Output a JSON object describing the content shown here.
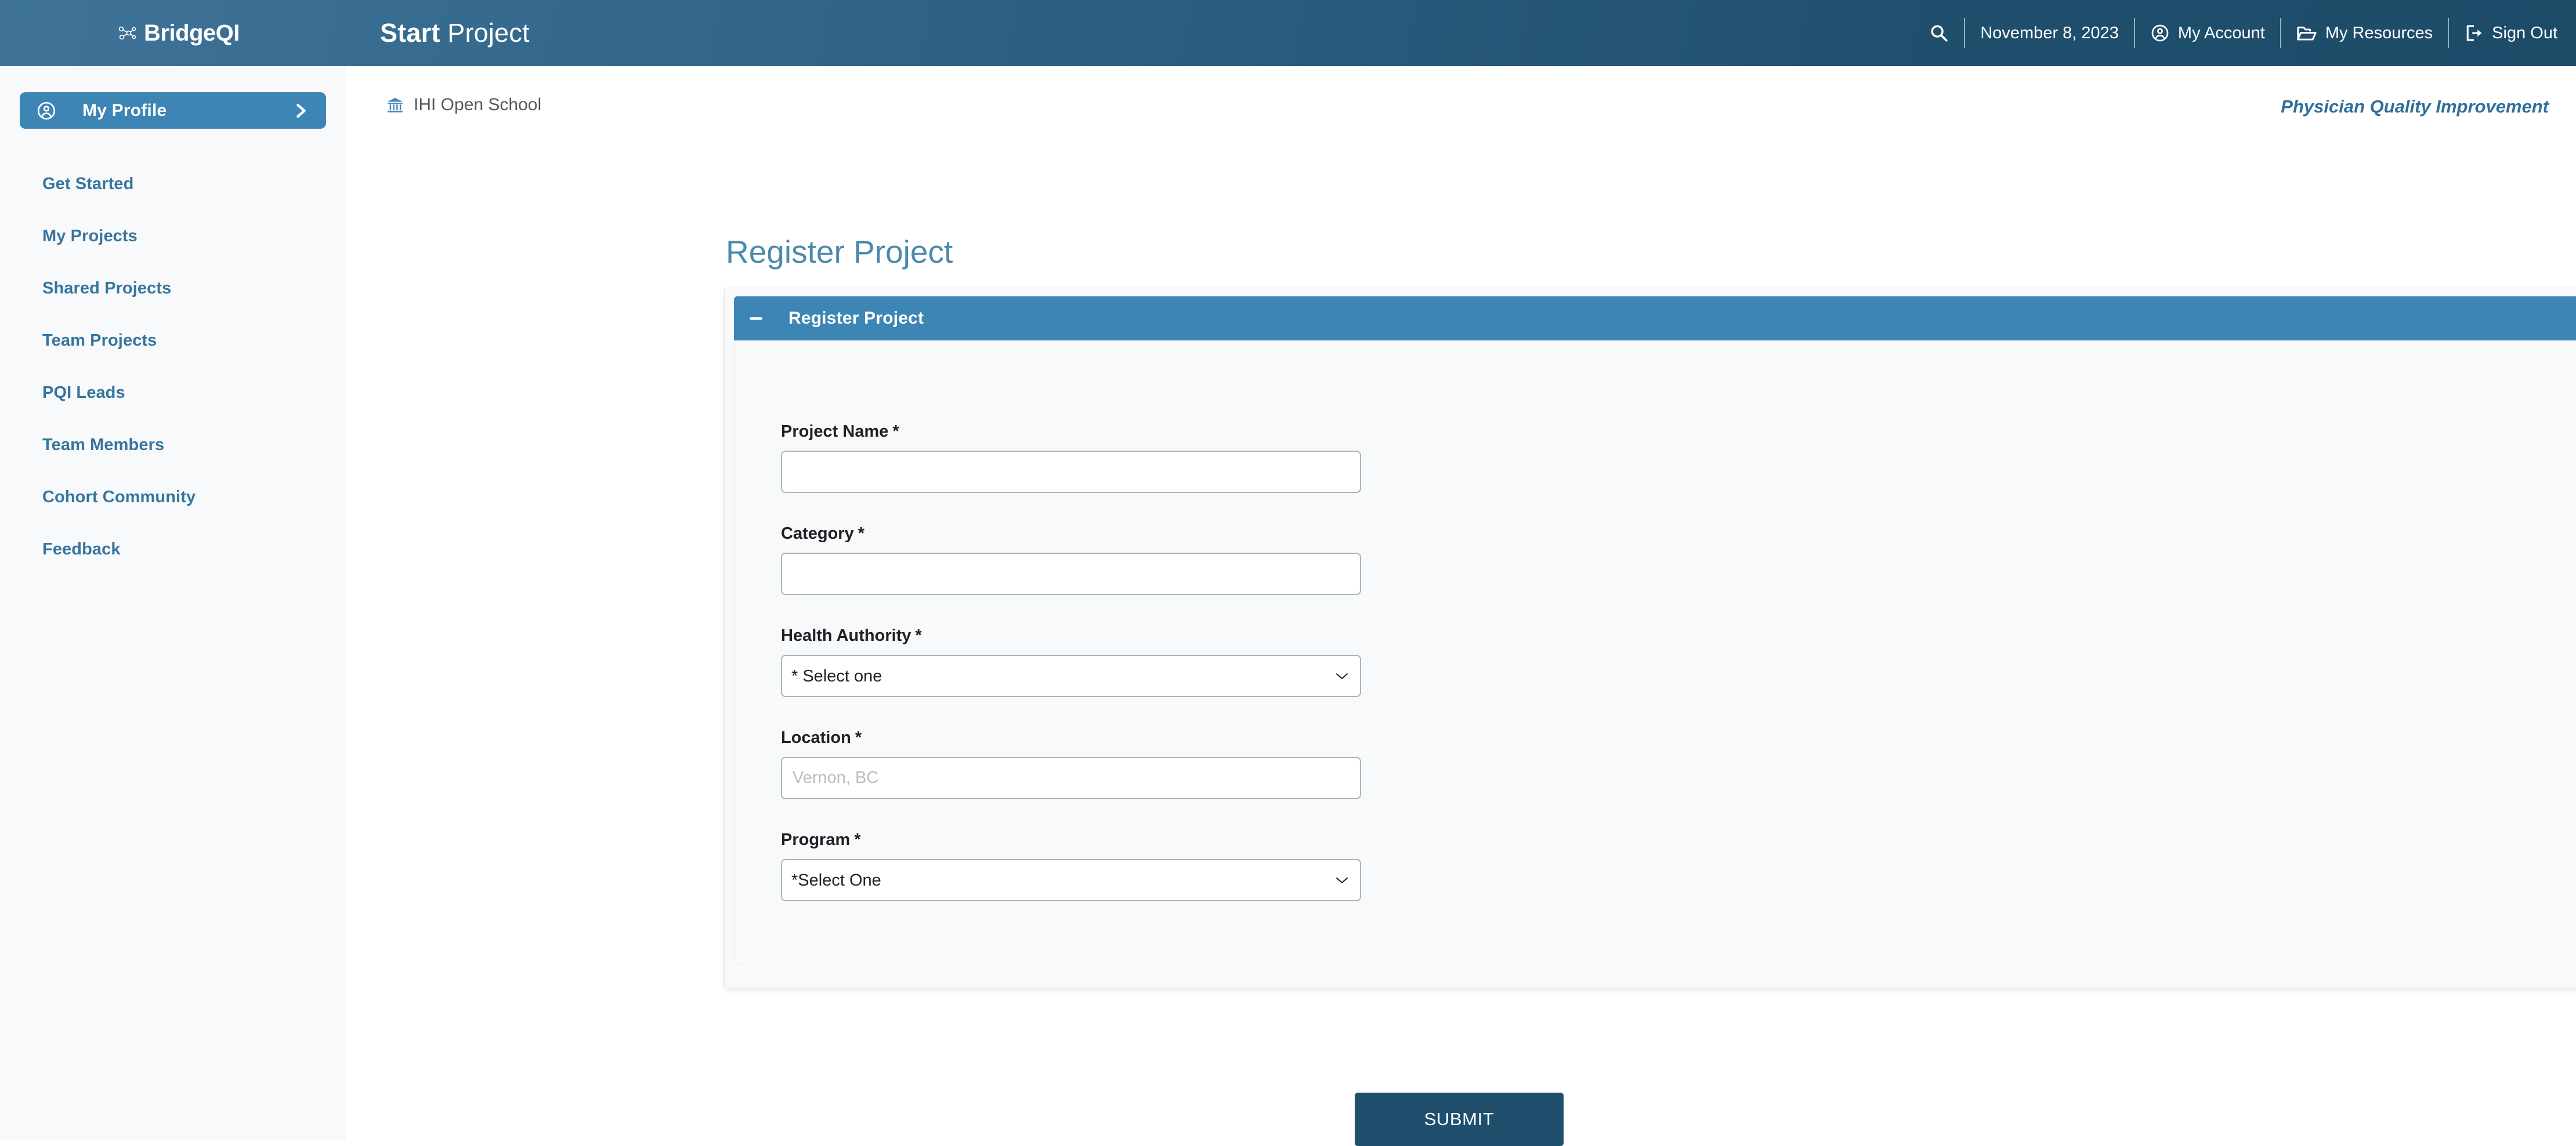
{
  "header": {
    "brand": "BridgeQI",
    "title_bold": "Start",
    "title_rest": " Project",
    "date": "November 8, 2023",
    "nav": [
      {
        "label": "My Account",
        "icon": "user-circle-icon"
      },
      {
        "label": "My Resources",
        "icon": "folder-open-icon"
      },
      {
        "label": "Sign Out",
        "icon": "sign-out-icon"
      }
    ],
    "search_icon": "search-icon",
    "colors": {
      "bar_left": "#3f7498",
      "bar_right": "#1d4c69"
    }
  },
  "sidebar": {
    "profile": {
      "label": "My Profile",
      "icon": "user-circle-icon",
      "chevron": "chevron-right-icon"
    },
    "items": [
      {
        "label": "Get Started"
      },
      {
        "label": "My Projects"
      },
      {
        "label": "Shared Projects"
      },
      {
        "label": "Team Projects"
      },
      {
        "label": "PQI Leads"
      },
      {
        "label": "Team Members"
      },
      {
        "label": "Cohort Community"
      },
      {
        "label": "Feedback"
      }
    ],
    "colors": {
      "active_bg": "#3d85b4",
      "link": "#36759d",
      "bg": "#f7f9fb"
    }
  },
  "breadcrumb": {
    "label": "IHI Open School",
    "icon": "bank-icon"
  },
  "program_label": "Physician Quality Improvement",
  "page": {
    "title": "Register Project"
  },
  "panel": {
    "title": "Register Project",
    "collapse_icon": "minus-icon",
    "expand_icon": "chevron-down-icon",
    "accent": "#3d85b4"
  },
  "form": {
    "fields": [
      {
        "key": "project_name",
        "label": "Project Name",
        "required_marker": "*",
        "type": "text",
        "value": "",
        "placeholder": ""
      },
      {
        "key": "category",
        "label": "Category",
        "required_marker": "*",
        "type": "text",
        "value": "",
        "placeholder": ""
      },
      {
        "key": "health_authority",
        "label": "Health Authority",
        "required_marker": "*",
        "type": "select",
        "value": "* Select one",
        "options": [
          "* Select one"
        ]
      },
      {
        "key": "location",
        "label": "Location",
        "required_marker": "*",
        "type": "text",
        "value": "",
        "placeholder": "Vernon, BC"
      },
      {
        "key": "program",
        "label": "Program",
        "required_marker": "*",
        "type": "select",
        "value": "*Select One",
        "options": [
          "*Select One"
        ]
      }
    ],
    "submit_label": "SUBMIT",
    "submit_color": "#1f4f6d"
  }
}
